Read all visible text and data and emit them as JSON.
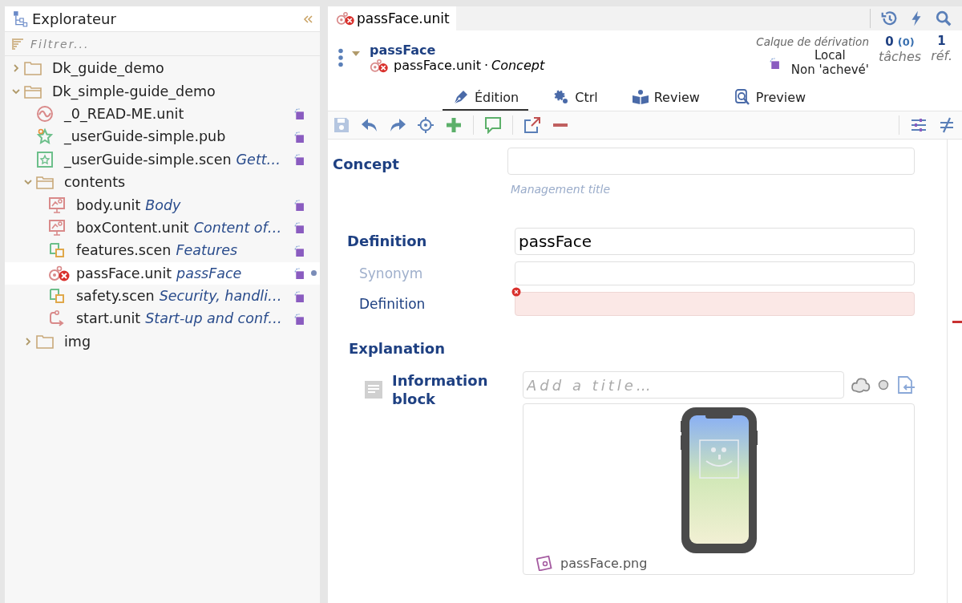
{
  "explorer": {
    "title": "Explorateur",
    "filter": {
      "placeholder": "Filtrer..."
    },
    "tree": [
      {
        "name": "Dk_guide_demo",
        "kind": "folder",
        "expanded": false
      },
      {
        "name": "Dk_simple-guide_demo",
        "kind": "folder",
        "expanded": true,
        "children": [
          {
            "name": "_0_READ-ME.unit",
            "kind": "readme",
            "selected": false
          },
          {
            "name": "_userGuide-simple.pub",
            "kind": "pub",
            "selected": false
          },
          {
            "name": "_userGuide-simple.scen",
            "title": "Gett…",
            "kind": "home",
            "selected": false
          },
          {
            "name": "contents",
            "kind": "folder",
            "expanded": true,
            "children": [
              {
                "name": "body.unit",
                "title": "Body",
                "kind": "screen",
                "selected": false
              },
              {
                "name": "boxContent.unit",
                "title": "Content of…",
                "kind": "screen",
                "selected": false
              },
              {
                "name": "features.scen",
                "title": "Features",
                "kind": "scen",
                "selected": false
              },
              {
                "name": "passFace.unit",
                "title": "passFace",
                "kind": "error",
                "selected": true
              },
              {
                "name": "safety.scen",
                "title": "Security, handli…",
                "kind": "scen",
                "selected": false
              },
              {
                "name": "start.unit",
                "title": "Start-up and conf…",
                "kind": "start",
                "selected": false
              }
            ]
          },
          {
            "name": "img",
            "kind": "folder",
            "expanded": false
          }
        ]
      }
    ]
  },
  "editor": {
    "tab": "passFace.unit",
    "header": {
      "title": "passFace",
      "file": "passFace.unit",
      "separator": "·",
      "type": "Concept",
      "layer_label": "Calque de dérivation",
      "layer": "Local",
      "status": "Non 'achevé'",
      "tasks": "0",
      "tasks_sub": "(0)",
      "tasks_label": "tâches",
      "refs": "1",
      "refs_label": "réf."
    },
    "tabs": [
      {
        "label": "Édition",
        "kind": "edit",
        "selected": true
      },
      {
        "label": "Ctrl",
        "kind": "ctrl",
        "selected": false
      },
      {
        "label": "Review",
        "kind": "review",
        "selected": false
      },
      {
        "label": "Preview",
        "kind": "preview",
        "selected": false
      }
    ],
    "form": {
      "concept": {
        "label": "Concept",
        "hint": "Management title"
      },
      "definition": {
        "label": "Definition",
        "fields": [
          {
            "kind": "term",
            "value": "passFace",
            "error": false
          },
          {
            "label": "Synonym",
            "kind": "synonym",
            "error": false
          },
          {
            "label": "Definition",
            "kind": "text",
            "error": true
          }
        ]
      },
      "explanation": {
        "label": "Explanation",
        "block_label": "Information block",
        "title_placeholder": "Add a title…",
        "image_caption": "passFace.png"
      }
    }
  }
}
